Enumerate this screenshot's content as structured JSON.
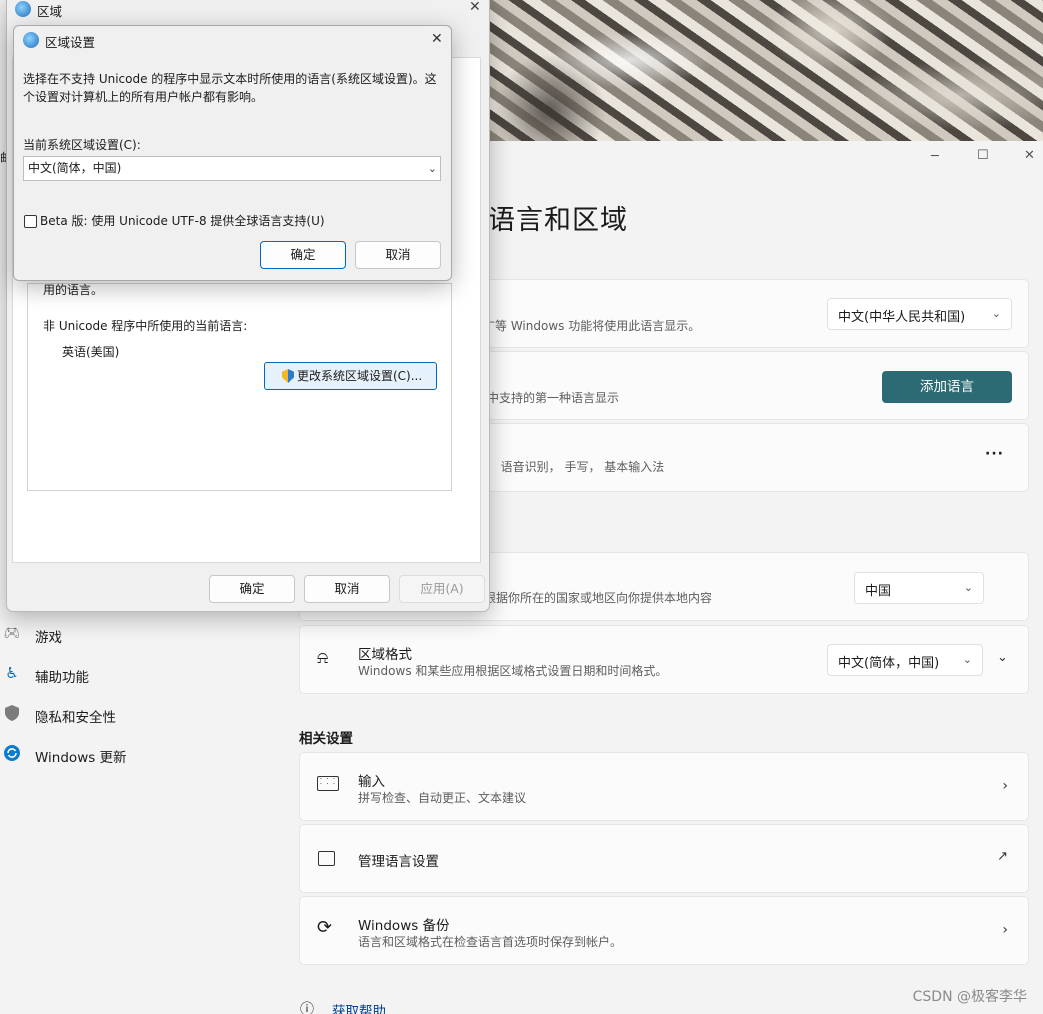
{
  "wallpaper": {
    "icon": "wallpaper-image"
  },
  "settings": {
    "window_controls": {
      "minimize": "─",
      "maximize": "☐",
      "close": "✕"
    },
    "page_title": "语言和区域",
    "cards": {
      "display_language": {
        "desc_fragment": "广等 Windows 功能将使用此语言显示。",
        "value": "中文(中华人民共和国)"
      },
      "preferred": {
        "desc_fragment": "中支持的第一种语言显示",
        "button": "添加语言"
      },
      "lang_pack": {
        "desc_fragment": "⁶， 语音识别， 手写， 基本输入法",
        "more": "···"
      },
      "country": {
        "desc_fragment": "根据你所在的国家或地区向你提供本地内容",
        "value": "中国"
      },
      "format": {
        "title": "区域格式",
        "desc": "Windows 和某些应用根据区域格式设置日期和时间格式。",
        "value": "中文(简体，中国)"
      }
    },
    "related_header": "相关设置",
    "related": [
      {
        "title": "输入",
        "desc": "拼写检查、自动更正、文本建议",
        "icon": "keyboard-icon"
      },
      {
        "title": "管理语言设置",
        "desc": "",
        "icon": "language-admin-icon"
      },
      {
        "title": "Windows 备份",
        "desc": "语言和区域格式在检查语言首选项时保存到帐户。",
        "icon": "backup-sync-icon"
      }
    ],
    "help_link": "获取帮助",
    "nav": [
      {
        "label": "游戏",
        "icon": "gamepad-icon"
      },
      {
        "label": "辅助功能",
        "icon": "accessibility-icon"
      },
      {
        "label": "隐私和安全性",
        "icon": "shield-icon"
      },
      {
        "label": "Windows 更新",
        "icon": "update-icon"
      }
    ],
    "left_edge_fragments": [
      "邮",
      "重"
    ]
  },
  "region_dialog": {
    "title": "区域",
    "close": "✕",
    "text_fragment": "用的语言。",
    "nonunicode_label": "非 Unicode 程序中所使用的当前语言:",
    "nonunicode_value": "英语(美国)",
    "change_button": "更改系统区域设置(C)...",
    "ok": "确定",
    "cancel": "取消",
    "apply": "应用(A)"
  },
  "locale_dialog": {
    "title": "区域设置",
    "close": "✕",
    "desc": "选择在不支持 Unicode 的程序中显示文本时所使用的语言(系统区域设置)。这个设置对计算机上的所有用户帐户都有影响。",
    "current_label": "当前系统区域设置(C):",
    "current_value": "中文(简体，中国)",
    "beta_label": "Beta 版: 使用 Unicode UTF-8 提供全球语言支持(U)",
    "beta_checked": false,
    "ok": "确定",
    "cancel": "取消"
  },
  "watermark": "CSDN @极客李华",
  "colors": {
    "accent": "#2c6b73",
    "accent_text": "#ffffff",
    "focus_border": "#0067c0"
  }
}
